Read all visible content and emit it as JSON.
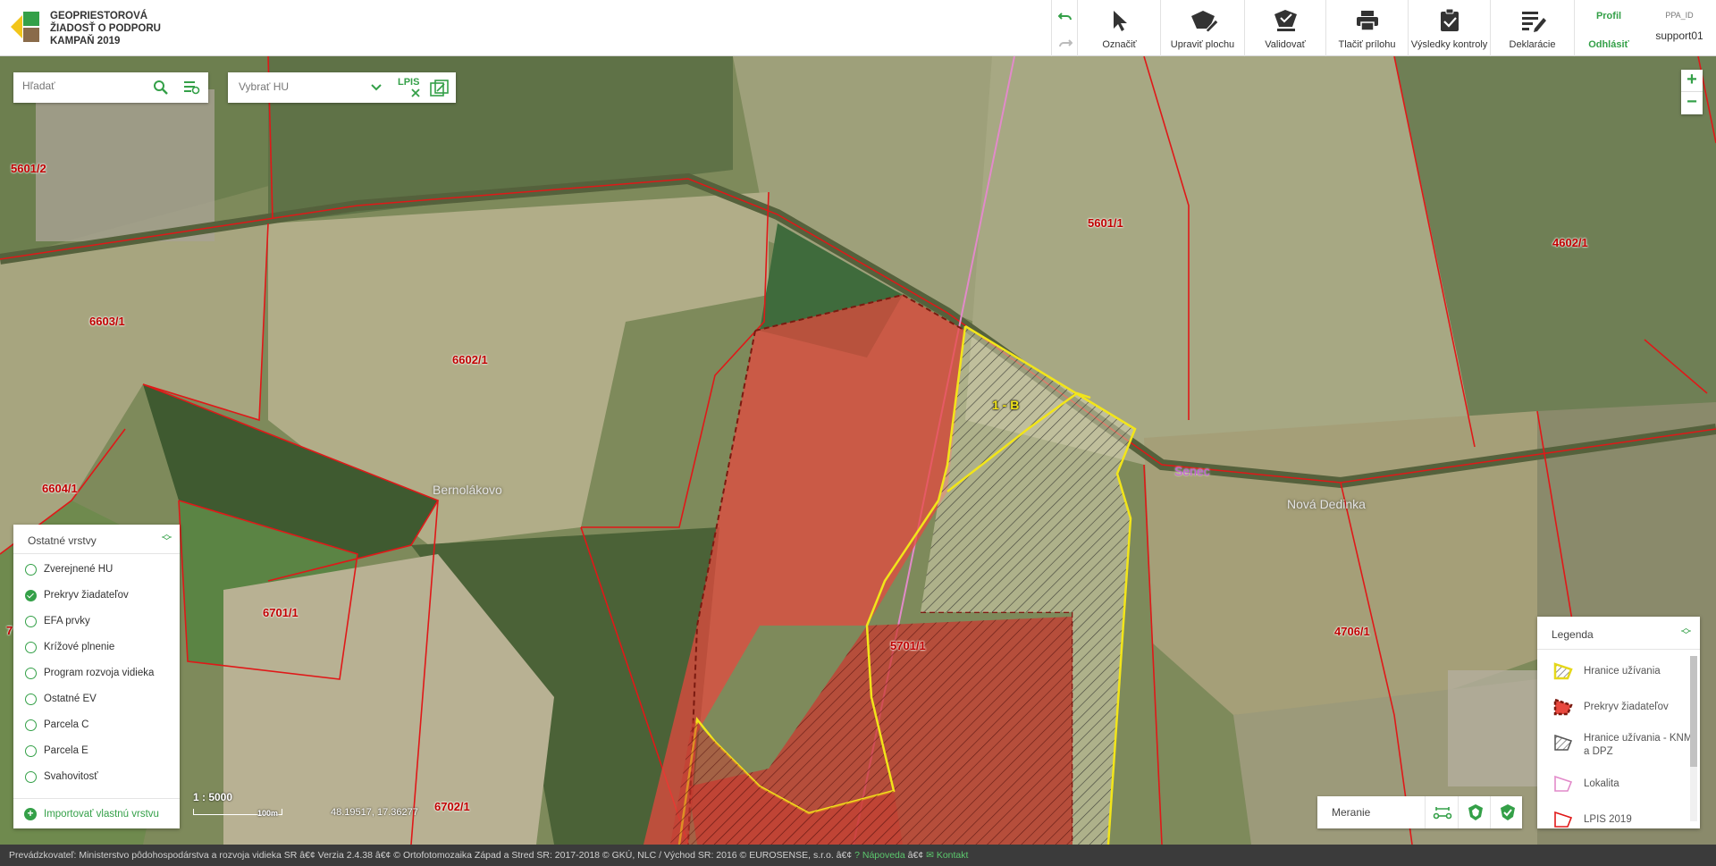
{
  "app": {
    "title_lines": [
      "GEOPRIESTOROVÁ",
      "ŽIADOSŤ O PODPORU",
      "KAMPAŇ 2019"
    ]
  },
  "toolbar": {
    "tools": [
      {
        "label": "Označiť",
        "icon": "cursor-icon"
      },
      {
        "label": "Upraviť plochu",
        "icon": "edit-area-icon"
      },
      {
        "label": "Validovať",
        "icon": "validate-icon"
      },
      {
        "label": "Tlačiť prílohu",
        "icon": "print-icon"
      },
      {
        "label": "Výsledky kontroly",
        "icon": "clipboard-check-icon"
      },
      {
        "label": "Deklarácie",
        "icon": "declarations-icon"
      }
    ],
    "profile_label": "Profil",
    "logout_label": "Odhlásiť",
    "user_id_label": "PPA_ID",
    "username": "support01"
  },
  "search": {
    "placeholder": "Hľadať",
    "hu_select": "Vybrať HU",
    "lpis_label": "LPIS"
  },
  "layers_panel": {
    "title": "Ostatné vrstvy",
    "items": [
      {
        "label": "Zverejnené HU",
        "checked": false
      },
      {
        "label": "Prekryv žiadateľov",
        "checked": true
      },
      {
        "label": "EFA prvky",
        "checked": false
      },
      {
        "label": "Krížové plnenie",
        "checked": false
      },
      {
        "label": "Program rozvoja vidieka",
        "checked": false
      },
      {
        "label": "Ostatné EV",
        "checked": false
      },
      {
        "label": "Parcela C",
        "checked": false
      },
      {
        "label": "Parcela E",
        "checked": false
      },
      {
        "label": "Svahovitosť",
        "checked": false
      }
    ],
    "import_label": "Importovať vlastnú vrstvu"
  },
  "legend": {
    "title": "Legenda",
    "items": [
      {
        "label": "Hranice užívania"
      },
      {
        "label": "Prekryv žiadateľov"
      },
      {
        "label": "Hranice užívania - KNM a DPZ"
      },
      {
        "label": "Lokalita"
      },
      {
        "label": "LPIS 2019"
      }
    ]
  },
  "measure": {
    "label": "Meranie"
  },
  "map": {
    "scale": "1 : 5000",
    "scale_unit": "100m",
    "coords": "48.19517, 17.36277",
    "parcel_labels": [
      "5601/2",
      "5601/1",
      "4602/1",
      "6603/1",
      "6602/1",
      "6604/1",
      "6701/1",
      "5701/1",
      "4706/1",
      "6702/1",
      "7"
    ],
    "selected_label": "1 - B",
    "places": [
      "Bernolákovo",
      "Senec",
      "Nová Dedinka"
    ],
    "colors": {
      "parcel_border": "#e01818",
      "usage_border": "#f2e51a",
      "overlap_fill": "#e8483e",
      "accent": "#34a048"
    }
  },
  "footer": {
    "text": "Prevádzkovateľ: Ministerstvo pôdohospodárstva a rozvoja vidieka SR â€¢ Verzia 2.4.38 â€¢ © Ortofotomozaika Západ a Stred SR: 2017-2018 © GKÚ, NLC / Východ SR: 2016 © EUROSENSE, s.r.o.  â€¢",
    "help": "Nápoveda",
    "sep": " â€¢ ",
    "contact": "Kontakt"
  }
}
